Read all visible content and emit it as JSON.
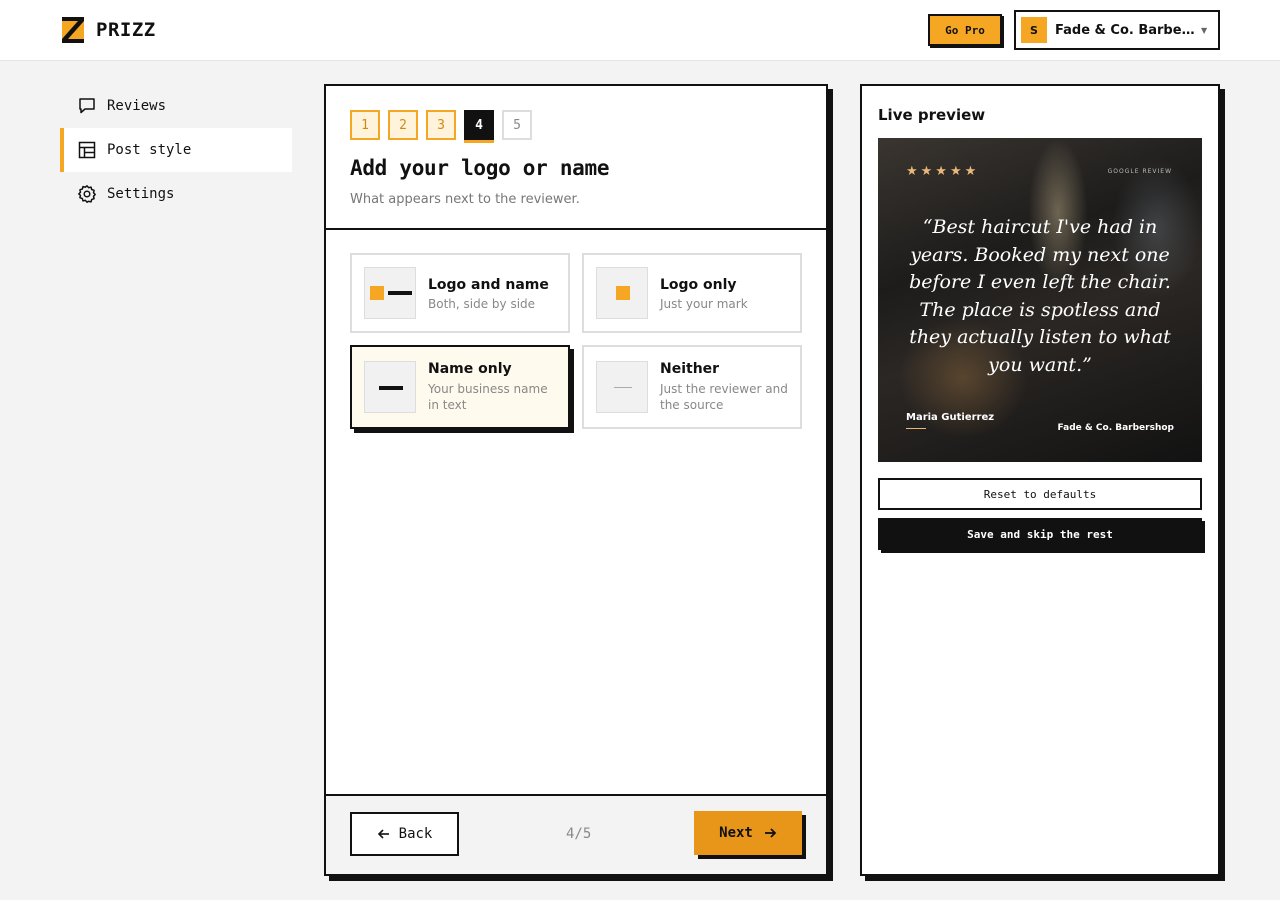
{
  "header": {
    "logo_text": "PRIZZ",
    "go_pro_label": "Go Pro",
    "business": {
      "initial": "S",
      "name": "Fade & Co. Barbershop"
    }
  },
  "sidebar": {
    "items": [
      {
        "label": "Reviews",
        "icon": "chat-bubble-icon",
        "active": false
      },
      {
        "label": "Post style",
        "icon": "layout-icon",
        "active": true
      },
      {
        "label": "Settings",
        "icon": "gear-icon",
        "active": false
      }
    ]
  },
  "wizard": {
    "steps": [
      "1",
      "2",
      "3",
      "4",
      "5"
    ],
    "current_step": 4,
    "title": "Add your logo or name",
    "subtitle": "What appears next to the reviewer.",
    "options": [
      {
        "title": "Logo and name",
        "desc": "Both, side by side",
        "selected": false
      },
      {
        "title": "Logo only",
        "desc": "Just your mark",
        "selected": false
      },
      {
        "title": "Name only",
        "desc": "Your business name in text",
        "selected": true
      },
      {
        "title": "Neither",
        "desc": "Just the reviewer and the source",
        "selected": false
      }
    ],
    "back_label": "Back",
    "next_label": "Next",
    "step_counter": "4/5"
  },
  "preview": {
    "title": "Live preview",
    "stars": "★★★★★",
    "source_label": "GOOGLE REVIEW",
    "quote": "“Best haircut I've had in years. Booked my next one before I even left the chair. The place is spotless and they actually listen to what you want.”",
    "reviewer": "Maria Gutierrez",
    "business_caption": "Fade & Co. Barbershop",
    "reset_label": "Reset to defaults",
    "save_label": "Save and skip the rest"
  },
  "colors": {
    "accent": "#f5a623",
    "accent_dark": "#e8961a",
    "ink": "#111111"
  }
}
